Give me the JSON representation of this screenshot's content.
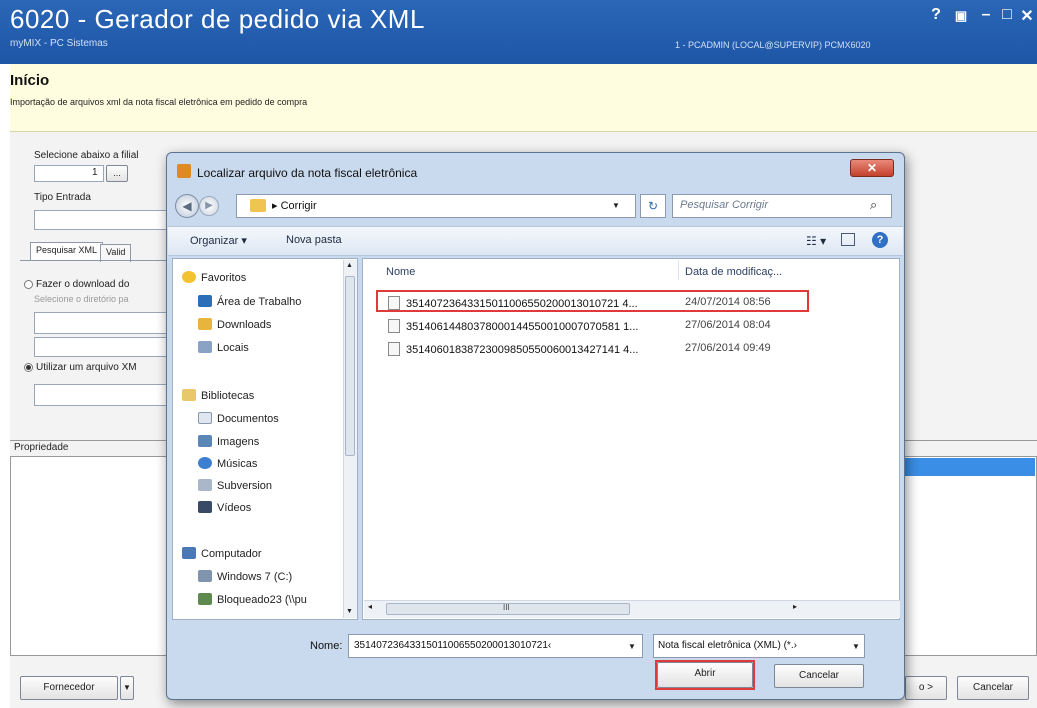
{
  "window": {
    "title": "6020 - Gerador de pedido via XML",
    "subtitle": "myMIX - PC Sistemas",
    "user_info": "1 - PCADMIN (LOCAL@SUPERVIP)  PCMX6020",
    "controls": [
      "?",
      "▣",
      "–",
      "□",
      "✕"
    ]
  },
  "banner": {
    "title": "Início",
    "description": "Importação de arquivos xml da nota fiscal eletrônica em pedido de compra"
  },
  "form": {
    "filial_label": "Selecione abaixo a filial",
    "filial_value": "1",
    "filial_button": "...",
    "tipo_entrada_label": "Tipo Entrada",
    "tabs": [
      "Pesquisar XML",
      "Valid"
    ],
    "radio_download": "Fazer o download do",
    "directory_hint": "Selecione o diretório pa",
    "radio_use_file": "Utilizar um arquivo XM",
    "property_header": "Propriedade",
    "supplier_button": "Fornecedor",
    "next_button": "o >",
    "cancel_button": "Cancelar"
  },
  "dialog": {
    "title": "Localizar arquivo da nota fiscal eletrônica",
    "close": "✕",
    "path": "Corrigir",
    "search_placeholder": "Pesquisar Corrigir",
    "toolbar": {
      "organize": "Organizar ▾",
      "new_folder": "Nova pasta"
    },
    "nav": {
      "favorites": "Favoritos",
      "desktop": "Área de Trabalho",
      "downloads": "Downloads",
      "places": "Locais",
      "libraries": "Bibliotecas",
      "documents": "Documentos",
      "images": "Imagens",
      "music": "Músicas",
      "subversion": "Subversion",
      "videos": "Vídeos",
      "computer": "Computador",
      "drive_c": "Windows 7 (C:)",
      "network": "Bloqueado23 (\\\\pu"
    },
    "columns": {
      "name": "Nome",
      "date": "Data de modificaç..."
    },
    "files": [
      {
        "name": "35140723643315011006550200013010721 4...",
        "date": "24/07/2014 08:56"
      },
      {
        "name": "35140614480378000144550010007070581 1...",
        "date": "27/06/2014 08:04"
      },
      {
        "name": "35140601838723009850550060013427141 4...",
        "date": "27/06/2014 09:49"
      }
    ],
    "name_label": "Nome:",
    "name_value": "35140723643315011006550200013010721‹",
    "file_type": "Nota fiscal eletrônica (XML) (*.›",
    "open_button": "Abrir",
    "cancel_button": "Cancelar",
    "hscroll_mark": "III"
  },
  "colors": {
    "titlebar": "#1e56a6",
    "banner": "#fffde0",
    "highlight": "#e0393a",
    "selection": "#3a8ee6"
  }
}
